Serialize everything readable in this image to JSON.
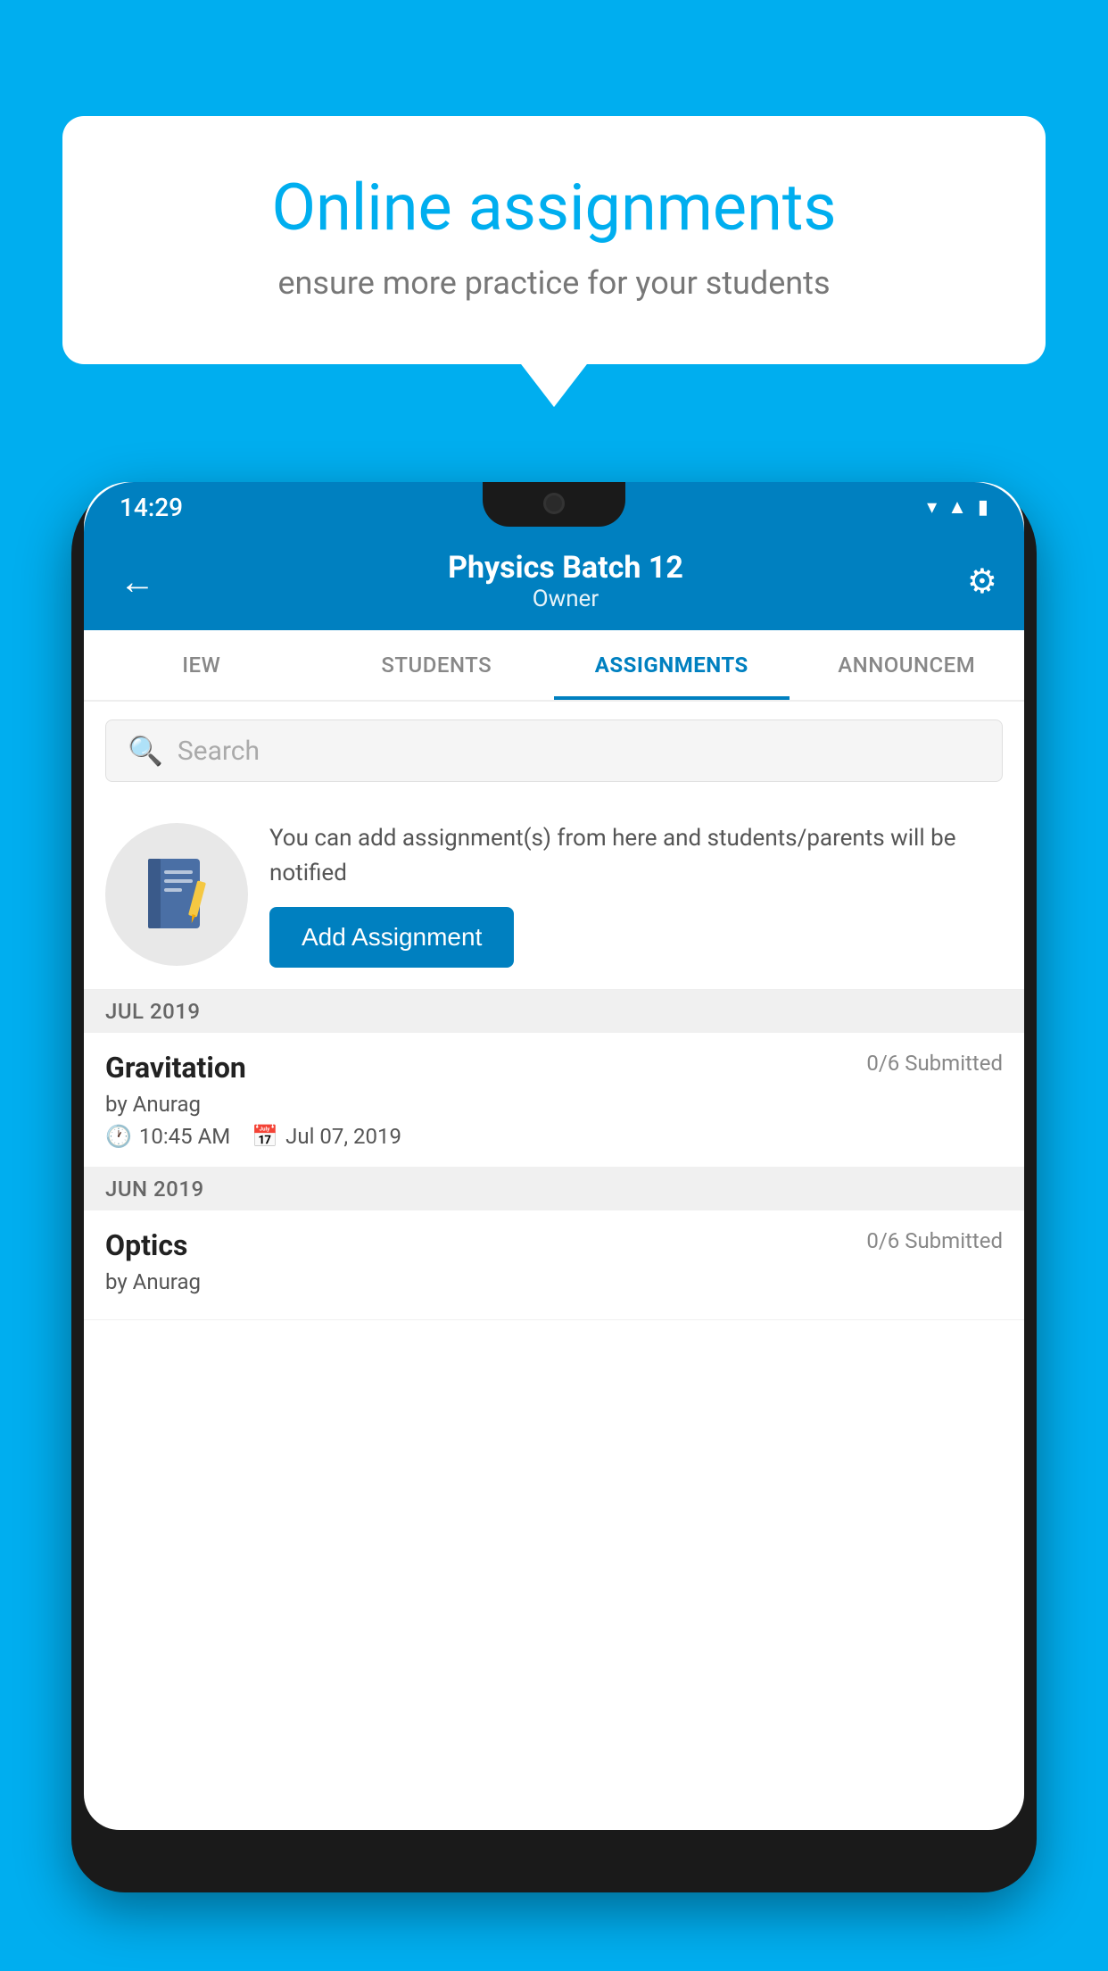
{
  "background": {
    "color": "#00AEEF"
  },
  "speech_bubble": {
    "title": "Online assignments",
    "subtitle": "ensure more practice for your students"
  },
  "phone": {
    "status_bar": {
      "time": "14:29",
      "icons": [
        "wifi",
        "signal",
        "battery"
      ]
    },
    "app_bar": {
      "title": "Physics Batch 12",
      "subtitle": "Owner",
      "back_label": "←",
      "settings_label": "⚙"
    },
    "tabs": [
      {
        "label": "IEW",
        "active": false
      },
      {
        "label": "STUDENTS",
        "active": false
      },
      {
        "label": "ASSIGNMENTS",
        "active": true
      },
      {
        "label": "ANNOUNCEM",
        "active": false
      }
    ],
    "search": {
      "placeholder": "Search"
    },
    "promo": {
      "text": "You can add assignment(s) from here and students/parents will be notified",
      "button_label": "Add Assignment"
    },
    "months": [
      {
        "label": "JUL 2019",
        "assignments": [
          {
            "title": "Gravitation",
            "submitted": "0/6 Submitted",
            "by": "by Anurag",
            "time": "10:45 AM",
            "date": "Jul 07, 2019"
          }
        ]
      },
      {
        "label": "JUN 2019",
        "assignments": [
          {
            "title": "Optics",
            "submitted": "0/6 Submitted",
            "by": "by Anurag",
            "time": "",
            "date": ""
          }
        ]
      }
    ]
  }
}
